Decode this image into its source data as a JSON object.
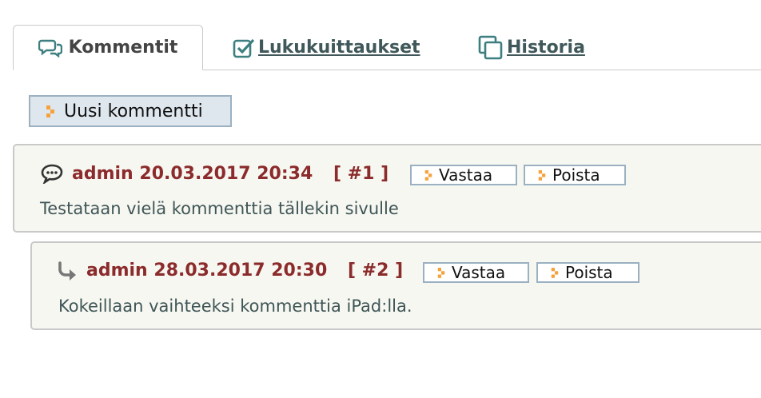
{
  "tabs": [
    {
      "label": "Kommentit",
      "icon": "comments-icon",
      "active": true
    },
    {
      "label": " Lukukuittaukset",
      "icon": "check-square-icon",
      "active": false
    },
    {
      "label": " Historia",
      "icon": "copy-icon",
      "active": false
    }
  ],
  "new_comment_label": "Uusi kommentti",
  "comments": [
    {
      "author": "admin",
      "timestamp": "20.03.2017 20:34",
      "number": "[ #1 ]",
      "icon": "speech-bubble-icon",
      "text": "Testataan vielä kommenttia tällekin sivulle",
      "reply_label": "Vastaa",
      "delete_label": "Poista"
    },
    {
      "author": "admin",
      "timestamp": "28.03.2017 20:30",
      "number": "[ #2 ]",
      "icon": "reply-arrow-icon",
      "text": "Kokeillaan vaihteeksi kommenttia iPad:lla.",
      "reply_label": "Vastaa",
      "delete_label": "Poista"
    }
  ],
  "colors": {
    "accent_red": "#8b2b2b",
    "tab_link": "#40585a",
    "button_border": "#9bb1c1",
    "marker_orange": "#f6a13a",
    "comment_bg": "#f7f7f2"
  }
}
